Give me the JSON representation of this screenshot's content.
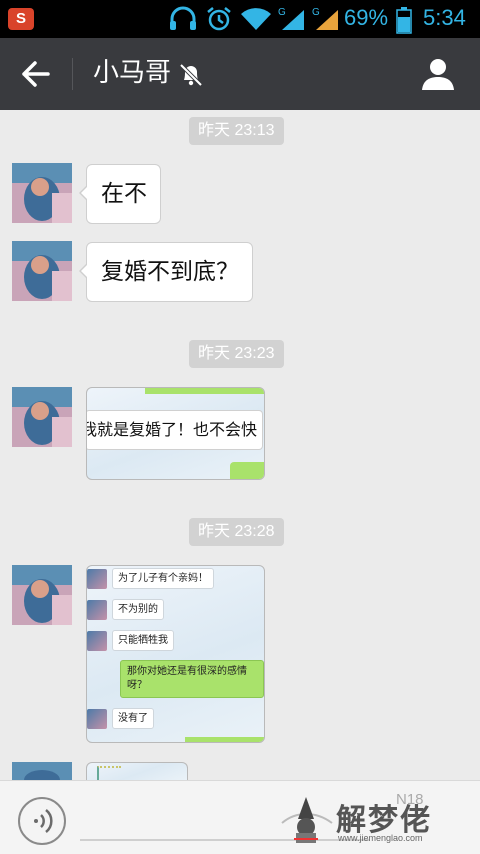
{
  "status_bar": {
    "app_badge": "S",
    "battery_percent": "69%",
    "time": "5:34"
  },
  "header": {
    "title": "小马哥",
    "back_icon": "arrow-left-icon",
    "mute_icon": "bell-muted-icon",
    "profile_icon": "person-icon"
  },
  "timestamps": [
    "昨天 23:13",
    "昨天 23:23",
    "昨天 23:28"
  ],
  "messages": [
    {
      "type": "text",
      "text": "在不"
    },
    {
      "type": "text",
      "text": "复婚不到底？"
    },
    {
      "type": "image",
      "visible_text": "我就是复婚了！也不会快"
    },
    {
      "type": "image",
      "rows": [
        "为了儿子有个亲妈！",
        "不为别的",
        "只能牺牲我"
      ],
      "green_text": "那你对她还是有很深的感情呀？",
      "last_row": "没有了"
    },
    {
      "type": "image",
      "partial": true
    }
  ],
  "input_bar": {
    "voice_icon": "voice-icon",
    "watermark": "解梦佬",
    "watermark_url": "www.jiemenglao.com",
    "watermark_faded": "N18"
  },
  "colors": {
    "title_bar": "#393a3e",
    "background": "#ebebeb",
    "status_accent": "#33b5e5",
    "timestamp_bg": "#d2d2d2",
    "self_bubble": "#a9e26b"
  }
}
